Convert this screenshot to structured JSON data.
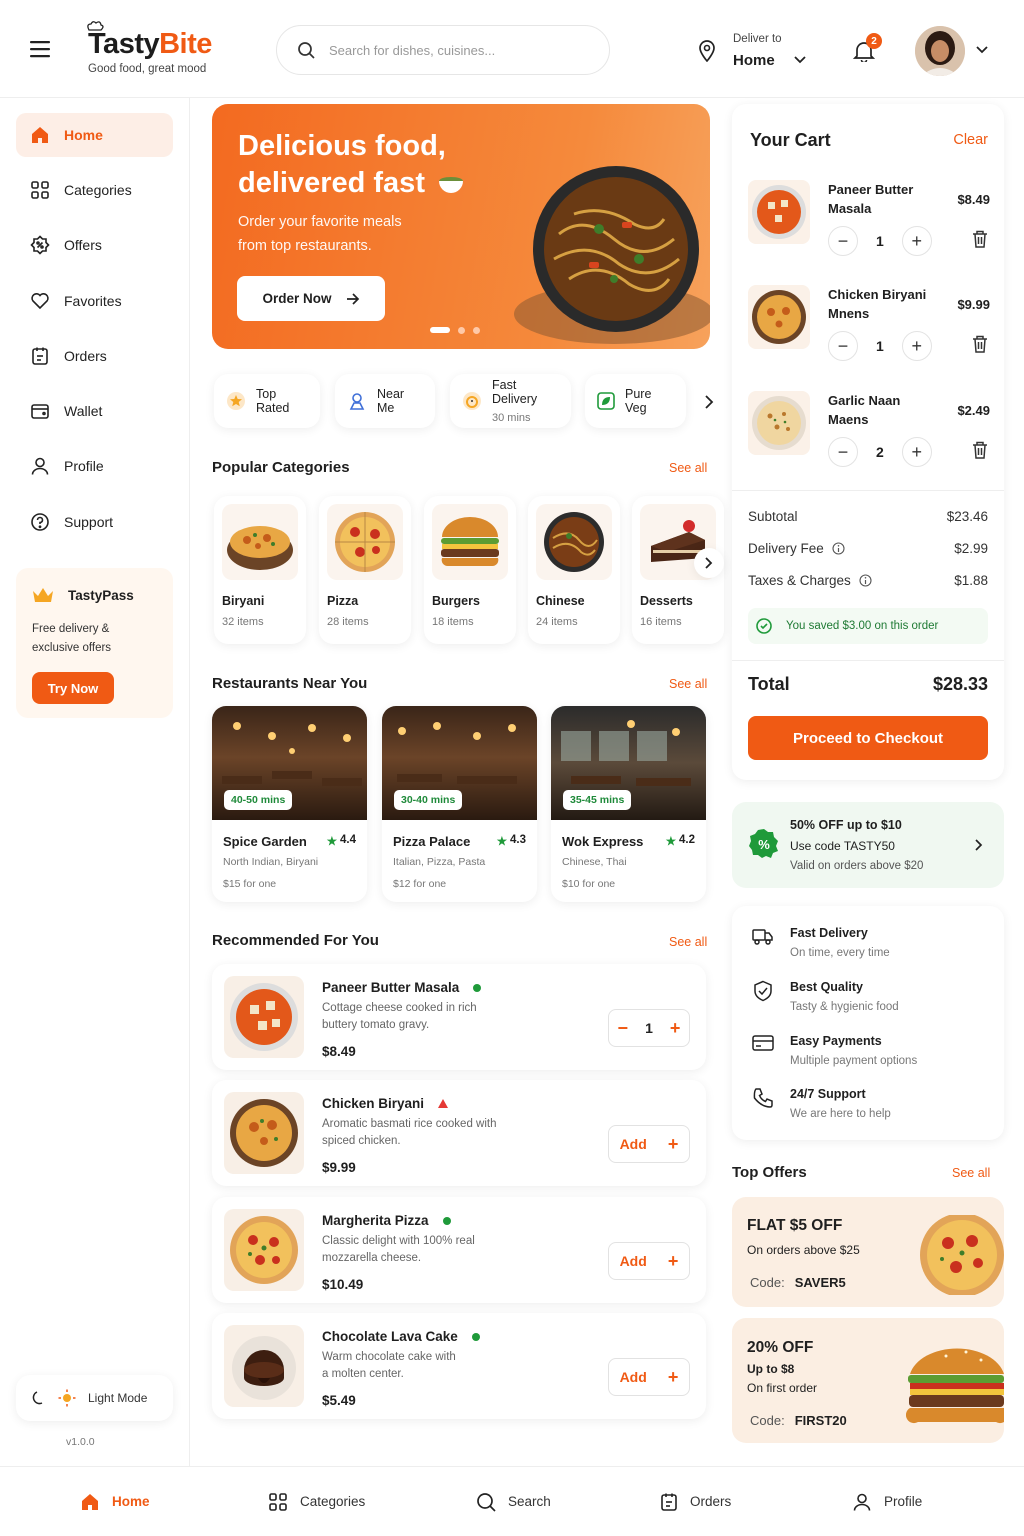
{
  "app": {
    "logo": "TastyBite",
    "tagline": "Good food, great mood"
  },
  "header": {
    "search_placeholder": "Search for dishes, cuisines...",
    "deliver_label": "Deliver to",
    "deliver_value": "Home",
    "notifications": "2"
  },
  "sidebar": {
    "items": [
      {
        "label": "Home"
      },
      {
        "label": "Categories"
      },
      {
        "label": "Offers"
      },
      {
        "label": "Favorites"
      },
      {
        "label": "Orders"
      },
      {
        "label": "Wallet"
      },
      {
        "label": "Profile"
      },
      {
        "label": "Support"
      }
    ],
    "pass": {
      "title": "TastyPass",
      "desc_1": "Free delivery &",
      "desc_2": "exclusive offers",
      "button": "Try Now"
    },
    "theme": "Light Mode",
    "version": "v1.0.0"
  },
  "banner": {
    "title_1": "Delicious food,",
    "title_2": "delivered fast",
    "sub_1": "Order your favorite meals",
    "sub_2": "from top restaurants.",
    "button": "Order Now"
  },
  "chips": [
    {
      "label": "Top Rated"
    },
    {
      "label": "Near Me"
    },
    {
      "label": "Fast Delivery",
      "sub": "30 mins"
    },
    {
      "label": "Pure Veg"
    }
  ],
  "categories": {
    "title": "Popular Categories",
    "see_all": "See all",
    "items": [
      {
        "name": "Biryani",
        "count": "32 items"
      },
      {
        "name": "Pizza",
        "count": "28 items"
      },
      {
        "name": "Burgers",
        "count": "18 items"
      },
      {
        "name": "Chinese",
        "count": "24 items"
      },
      {
        "name": "Desserts",
        "count": "16 items"
      }
    ]
  },
  "restaurants": {
    "title": "Restaurants Near You",
    "see_all": "See all",
    "items": [
      {
        "time": "40-50 mins",
        "name": "Spice Garden",
        "rating": "4.4",
        "cuisine": "North Indian, Biryani",
        "price": "$15 for one"
      },
      {
        "time": "30-40 mins",
        "name": "Pizza Palace",
        "rating": "4.3",
        "cuisine": "Italian, Pizza, Pasta",
        "price": "$12 for one"
      },
      {
        "time": "35-45 mins",
        "name": "Wok Express",
        "rating": "4.2",
        "cuisine": "Chinese, Thai",
        "price": "$10 for one"
      }
    ]
  },
  "recommended": {
    "title": "Recommended For You",
    "see_all": "See all",
    "items": [
      {
        "name": "Paneer Butter Masala",
        "desc_1": "Cottage cheese cooked in rich",
        "desc_2": "buttery tomato gravy.",
        "price": "$8.49",
        "qty": "1",
        "add": ""
      },
      {
        "name": "Chicken Biryani",
        "desc_1": "Aromatic basmati rice cooked with",
        "desc_2": "spiced chicken.",
        "price": "$9.99",
        "add": "Add"
      },
      {
        "name": "Margherita Pizza",
        "desc_1": "Classic delight with 100% real",
        "desc_2": "mozzarella cheese.",
        "price": "$10.49",
        "add": "Add"
      },
      {
        "name": "Chocolate Lava Cake",
        "desc_1": "Warm chocolate cake with",
        "desc_2": "a molten center.",
        "price": "$5.49",
        "add": "Add"
      }
    ]
  },
  "cart": {
    "title": "Your Cart",
    "clear": "Clear",
    "items": [
      {
        "name_1": "Paneer Butter",
        "name_2": "Masala",
        "price": "$8.49",
        "qty": "1"
      },
      {
        "name_1": "Chicken Biryani",
        "name_2": "Mnens",
        "price": "$9.99",
        "qty": "1"
      },
      {
        "name_1": "Garlic Naan",
        "name_2": "Maens",
        "price": "$2.49",
        "qty": "2"
      }
    ],
    "subtotal_label": "Subtotal",
    "subtotal": "$23.46",
    "delivery_label": "Delivery Fee",
    "delivery": "$2.99",
    "taxes_label": "Taxes & Charges",
    "taxes": "$1.88",
    "saved": "You saved $3.00 on this order",
    "total_label": "Total",
    "total": "$28.33",
    "checkout": "Proceed to Checkout"
  },
  "promo": {
    "title": "50% OFF up to $10",
    "code_line": "Use code TASTY50",
    "valid": "Valid on orders above $20"
  },
  "features": [
    {
      "title": "Fast Delivery",
      "sub": "On time, every time"
    },
    {
      "title": "Best Quality",
      "sub": "Tasty & hygienic food"
    },
    {
      "title": "Easy Payments",
      "sub": "Multiple payment options"
    },
    {
      "title": "24/7 Support",
      "sub": "We are here to help"
    }
  ],
  "top_offers": {
    "title": "Top Offers",
    "see_all": "See all",
    "items": [
      {
        "title": "FLAT $5 OFF",
        "line_1": "On orders above $25",
        "line_2": "",
        "code_label": "Code:",
        "code": "SAVER5"
      },
      {
        "title": "20% OFF",
        "line_1": "Up to $8",
        "line_2": "On first order",
        "code_label": "Code:",
        "code": "FIRST20"
      }
    ]
  },
  "bottom_nav": [
    {
      "label": "Home"
    },
    {
      "label": "Categories"
    },
    {
      "label": "Search"
    },
    {
      "label": "Orders"
    },
    {
      "label": "Profile"
    }
  ],
  "colors": {
    "accent": "#f05a14",
    "veg": "#1f9a3a",
    "nonveg": "#e53935"
  }
}
